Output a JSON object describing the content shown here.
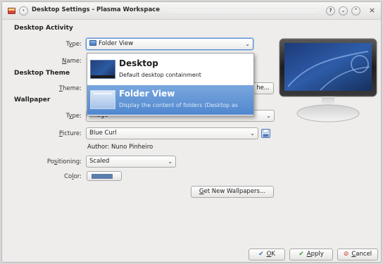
{
  "window": {
    "title": "Desktop Settings - Plasma Workspace"
  },
  "titlebar_buttons": {
    "help": "?",
    "minimize": "⌄",
    "maximize": "⌃",
    "close": "×"
  },
  "sections": {
    "activity": "Desktop Activity",
    "theme": "Desktop Theme",
    "wallpaper": "Wallpaper"
  },
  "fields": {
    "type_label_pre": "T",
    "type_label_ul": "y",
    "type_label_post": "pe:",
    "type_value": "Folder View",
    "name_label_pre": "",
    "name_label_ul": "N",
    "name_label_post": "ame:",
    "theme_label_pre": "",
    "theme_label_ul": "T",
    "theme_label_post": "heme:",
    "theme_button_tail": "he...",
    "wp_type_label_pre": "T",
    "wp_type_label_ul": "y",
    "wp_type_label_post": "pe:",
    "wp_type_value": "Image",
    "picture_label_pre": "",
    "picture_label_ul": "P",
    "picture_label_post": "icture:",
    "picture_value": "Blue Curl",
    "author_text": "Author: Nuno Pinheiro",
    "positioning_label_pre": "Po",
    "positioning_label_ul": "s",
    "positioning_label_post": "itioning:",
    "positioning_value": "Scaled",
    "color_label_pre": "Co",
    "color_label_ul": "l",
    "color_label_post": "or:",
    "get_new_pre": "",
    "get_new_ul": "G",
    "get_new_post": "et New Wallpapers..."
  },
  "popup": {
    "items": [
      {
        "name": "Desktop",
        "desc": "Default desktop containment"
      },
      {
        "name": "Folder View",
        "desc": "Display the content of folders (Desktop as"
      }
    ]
  },
  "footer": {
    "ok_pre": "",
    "ok_ul": "O",
    "ok_post": "K",
    "apply_pre": "",
    "apply_ul": "A",
    "apply_post": "pply",
    "cancel_pre": "",
    "cancel_ul": "C",
    "cancel_post": "ancel"
  },
  "colors": {
    "accent": "#4f87cf",
    "wallpaper_color": "#5b7dac",
    "cancel_icon": "#c8322a",
    "ok_icon": "#3c6fb5",
    "apply_icon": "#3d9b35"
  },
  "icons": {
    "app": "plasma-desktop-icon",
    "save": "floppy-save-icon",
    "ok": "checkmark-icon",
    "apply": "checkmark-icon",
    "cancel": "cancel-icon"
  }
}
